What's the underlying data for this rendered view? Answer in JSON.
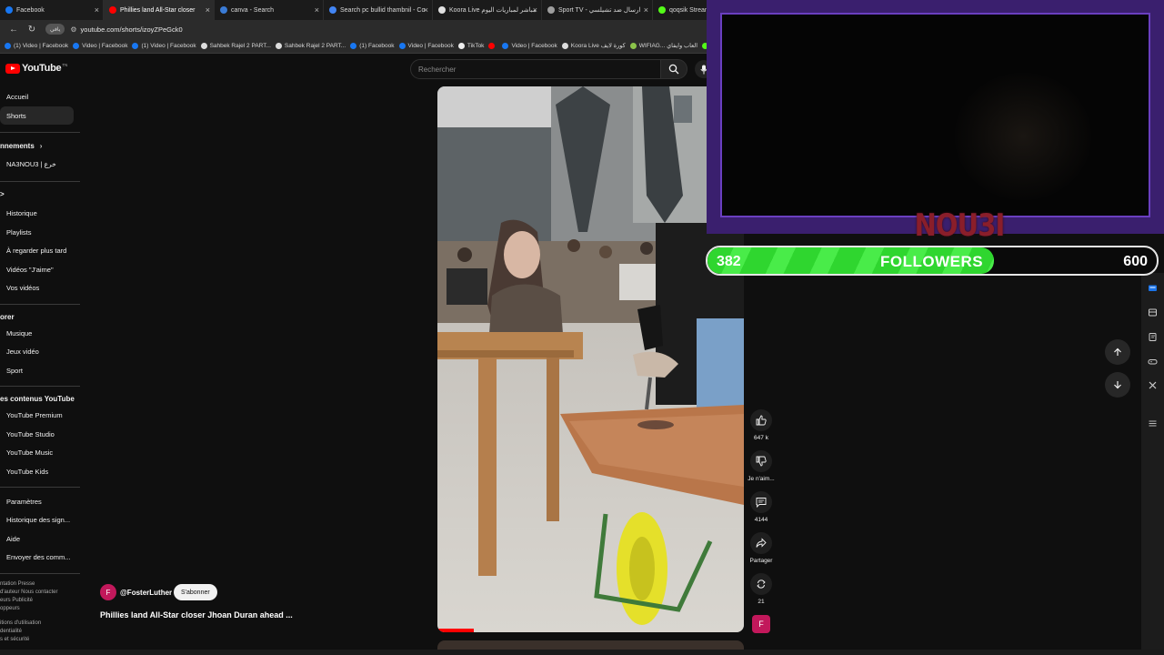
{
  "tabs": [
    {
      "label": "Facebook",
      "color": "#1877f2",
      "active": false
    },
    {
      "label": "Phillies land All-Star closer",
      "color": "#ff0000",
      "active": true
    },
    {
      "label": "canva - Search",
      "color": "#3a7bd5",
      "active": false
    },
    {
      "label": "Search pc bullid thambnil - Co",
      "color": "#4285f4",
      "active": false
    },
    {
      "label": "Koora Live مباشر لمباريات اليوم",
      "color": "#e0e0e0",
      "active": false
    },
    {
      "label": "Sport TV - ارسال ضد تشيلسي",
      "color": "#9e9e9e",
      "active": false
    },
    {
      "label": "qoqsik Stream",
      "color": "#53fc18",
      "active": false
    }
  ],
  "address": {
    "site_label": "يافي",
    "url": "youtube.com/shorts/izoyZPeGck0"
  },
  "bookmarks": [
    {
      "label": "(1) Video | Facebook",
      "color": "#1877f2"
    },
    {
      "label": "Video | Facebook",
      "color": "#1877f2"
    },
    {
      "label": "(1) Video | Facebook",
      "color": "#1877f2"
    },
    {
      "label": "Sahbek Rajel 2 PART...",
      "color": "#dddddd"
    },
    {
      "label": "Sahbek Rajel 2 PART...",
      "color": "#dddddd"
    },
    {
      "label": "(1) Facebook",
      "color": "#1877f2"
    },
    {
      "label": "Video | Facebook",
      "color": "#1877f2"
    },
    {
      "label": "TikTok",
      "color": "#eeeeee"
    },
    {
      "label": "",
      "color": "#ff0000"
    },
    {
      "label": "Video | Facebook",
      "color": "#1877f2"
    },
    {
      "label": "Koora Live كورة لايف",
      "color": "#dddddd"
    },
    {
      "label": "WIFIAG... العاب وايفاي",
      "color": "#8bc34a"
    },
    {
      "label": "",
      "color": "#53fc18"
    }
  ],
  "youtube": {
    "logo_text": "YouTube",
    "logo_tm": "TN",
    "search_placeholder": "Rechercher"
  },
  "sidebar": {
    "accueil": "Accueil",
    "shorts": "Shorts",
    "abonnements": "nnements",
    "channel": "NA3NOU3 | خرع",
    "vous": ">",
    "historique": "Historique",
    "playlists": "Playlists",
    "plus_tard": "À regarder plus tard",
    "jaime": "Vidéos \"J'aime\"",
    "vos_videos": "Vos vidéos",
    "explorer": "orer",
    "musique": "Musique",
    "jeux": "Jeux vidéo",
    "sport": "Sport",
    "plus_youtube": "es contenus YouTube",
    "premium": "YouTube Premium",
    "studio": "YouTube Studio",
    "music": "YouTube Music",
    "kids": "YouTube Kids",
    "parametres": "Paramètres",
    "historique_sign": "Historique des sign...",
    "aide": "Aide",
    "envoyer": "Envoyer des comm...",
    "footer1": "ntation  Presse",
    "footer2": "d'auteur  Nous contacter",
    "footer3": "eurs  Publicité",
    "footer4": "oppeurs",
    "footer5": "itions d'utilisation",
    "footer6": "dentialité",
    "footer7": "s et sécurité"
  },
  "short": {
    "channel_initial": "F",
    "channel": "@FosterLuther",
    "subscribe": "S'abonner",
    "title": "Phillies land All-Star closer Jhoan Duran ahead ...",
    "likes": "647 k",
    "dislike": "Je n'aim...",
    "comments": "4144",
    "share": "Partager",
    "remix": "21"
  },
  "overlay": {
    "streamer": "NOU3I",
    "goal_current": "382",
    "goal_label": "FOLLOWERS",
    "goal_target": "600",
    "goal_progress": 0.6367,
    "accent": "#6a3fc0",
    "bar_color": "#2fd62f"
  }
}
